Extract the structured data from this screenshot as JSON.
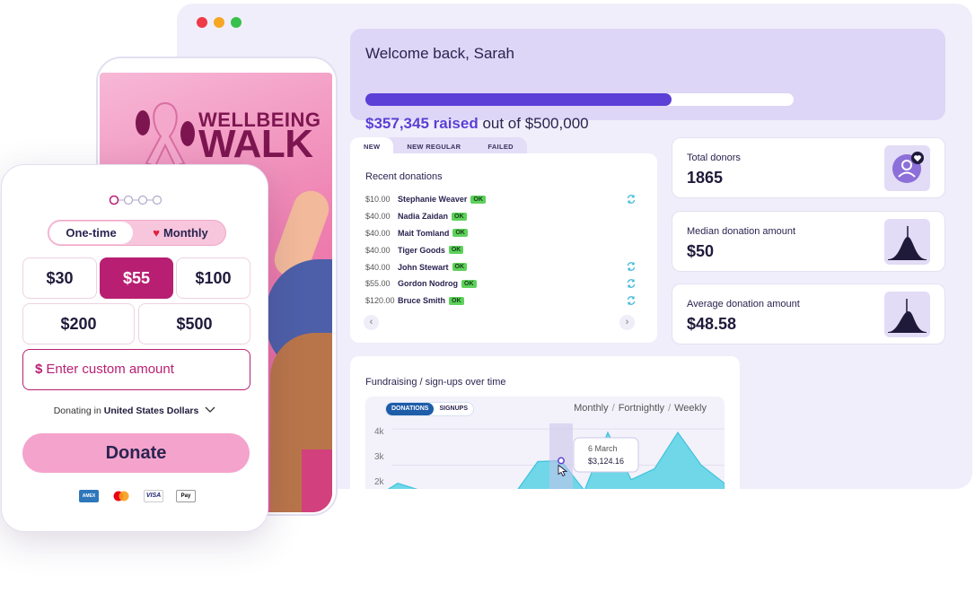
{
  "dashboard": {
    "welcome": "Welcome back, Sarah",
    "raised": "$357,345 raised",
    "out_of": " out of $500,000",
    "progress_fraction": 0.714,
    "tabs": [
      "NEW",
      "NEW REGULAR",
      "FAILED"
    ],
    "recent_title": "Recent donations",
    "donations": [
      {
        "amount": "$10.00",
        "name": "Stephanie Weaver",
        "status": "OK",
        "recurring": true
      },
      {
        "amount": "$40.00",
        "name": "Nadia Zaidan",
        "status": "OK",
        "recurring": false
      },
      {
        "amount": "$40.00",
        "name": "Mait Tomland",
        "status": "OK",
        "recurring": false
      },
      {
        "amount": "$40.00",
        "name": "Tiger Goods",
        "status": "OK",
        "recurring": false
      },
      {
        "amount": "$40.00",
        "name": "John Stewart",
        "status": "OK",
        "recurring": true
      },
      {
        "amount": "$55.00",
        "name": "Gordon Nodrog",
        "status": "OK",
        "recurring": true
      },
      {
        "amount": "$120.00",
        "name": "Bruce Smith",
        "status": "OK",
        "recurring": true
      }
    ],
    "stats": [
      {
        "label": "Total donors",
        "value": "1865",
        "icon": "donor-heart-icon"
      },
      {
        "label": "Median donation amount",
        "value": "$50",
        "icon": "distribution-icon"
      },
      {
        "label": "Average donation amount",
        "value": "$48.58",
        "icon": "distribution-icon"
      }
    ],
    "chart_title": "Fundraising / sign-ups over time",
    "chart_toggle": [
      "DONATIONS",
      "SIGNUPS"
    ],
    "periods": [
      "Monthly",
      "Fortnightly",
      "Weekly"
    ],
    "tooltip_date": "6 March",
    "tooltip_value": "$3,124.16"
  },
  "chart_data": {
    "type": "area",
    "yticks": [
      "4k",
      "3k",
      "2k"
    ],
    "y_values": [
      2100,
      2500,
      2300,
      1500,
      1200,
      1400,
      2200,
      3100,
      3124,
      2300,
      3900,
      2600,
      2900,
      3900,
      3000,
      2500
    ],
    "ylim": [
      1800,
      4200
    ],
    "highlight_label": "6 March",
    "highlight_value": 3124.16,
    "color": "#6fd7e8"
  },
  "campaign": {
    "logo_line1": "WELLBEING",
    "logo_line2": "WALK"
  },
  "donate": {
    "frequency_options": [
      "One-time",
      "Monthly"
    ],
    "selected_frequency": "One-time",
    "amounts_row1": [
      "$30",
      "$55",
      "$100"
    ],
    "amounts_row2": [
      "$200",
      "$500"
    ],
    "selected_amount": "$55",
    "custom_prefix": "$",
    "custom_placeholder": "Enter custom amount",
    "currency_prefix": "Donating in ",
    "currency": "United States Dollars",
    "button": "Donate",
    "payment_methods": [
      "AMEX",
      "mastercard",
      "VISA",
      "Pay"
    ]
  },
  "colors": {
    "accent_purple": "#5b3fd6",
    "brand_magenta": "#b81f72",
    "donate_pink": "#f4a3cc",
    "ok_green": "#5dd15b"
  }
}
